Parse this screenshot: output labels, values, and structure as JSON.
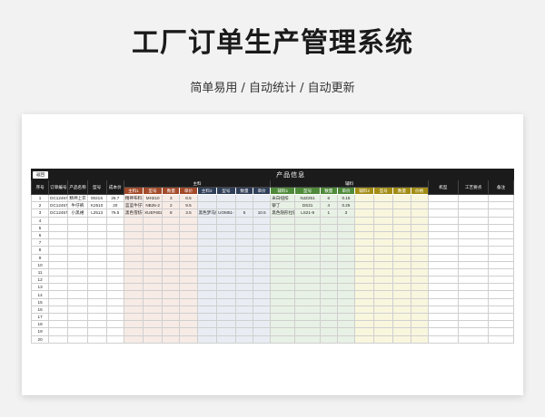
{
  "page": {
    "title": "工厂订单生产管理系统",
    "subtitle": "简单易用  /  自动统计  /  自动更新"
  },
  "sheet": {
    "back_label": "返回",
    "sheet_title": "产品信息",
    "group_labels": {
      "main": "主料",
      "aux": "辅料"
    },
    "columns": {
      "seq": "序号",
      "order_no": "订单编号",
      "product_name": "产品名称",
      "model": "型号",
      "cost_price": "成本价",
      "machine": "机型",
      "key_process": "工艺要点",
      "remarks": "备注"
    },
    "main_sub_a": [
      "主料1",
      "型号",
      "数量",
      "单价"
    ],
    "main_sub_b": [
      "主料2",
      "型号",
      "数量",
      "单价"
    ],
    "aux_sub_a": [
      "辅料1",
      "型号",
      "数量",
      "单价"
    ],
    "aux_sub_b": [
      "辅料2",
      "型号",
      "数量",
      "价格"
    ],
    "colors": {
      "banner": "#1b1b1b",
      "main_a_header": "#a34a2a",
      "main_b_header": "#2f3e57",
      "aux_a_header": "#4f8a3a",
      "aux_b_header": "#a28c14",
      "main_a_fill": "#f7ebe6",
      "main_b_fill": "#e9edf3",
      "aux_a_fill": "#e8f1e5",
      "aux_b_fill": "#f9f6de"
    },
    "rows": [
      {
        "seq": "1",
        "order_no": "DC124578",
        "product_name": "精神上衣",
        "model": "0021S",
        "cost_price": "26.7",
        "m1": "精神布料1",
        "m1_model": "MH210",
        "m1_qty": "3",
        "m1_price": "8.5",
        "m2": "",
        "m2_model": "",
        "m2_qty": "",
        "m2_price": "",
        "a1": "米白纽扣",
        "a1_model": "NJZ251",
        "a1_qty": "6",
        "a1_price": "0.15"
      },
      {
        "seq": "2",
        "order_no": "DC124578",
        "product_name": "牛仔裤",
        "model": "K2510",
        "cost_price": "20",
        "m1": "蓝蓝牛仔布",
        "m1_model": "NB25-2",
        "m1_qty": "2",
        "m1_price": "9.5",
        "m2": "",
        "m2_model": "",
        "m2_qty": "",
        "m2_price": "",
        "a1": "铆丁",
        "a1_model": "DS21",
        "a1_qty": "4",
        "a1_price": "0.25"
      },
      {
        "seq": "3",
        "order_no": "DC124578",
        "product_name": "小黑裙",
        "model": "L2513",
        "cost_price": "76.5",
        "m1": "黑色雪纺布料",
        "m1_model": "XUEF602",
        "m1_qty": "8",
        "m1_price": "3.5",
        "m2": "黑色梦马织布",
        "m2_model": "UOM51-",
        "m2_qty": "5",
        "m2_price": "10.5",
        "a1": "黑色隐形拉链",
        "a1_model": "LS21-9",
        "a1_qty": "1",
        "a1_price": "3"
      }
    ],
    "row_numbers": [
      "4",
      "5",
      "6",
      "7",
      "8",
      "9",
      "10",
      "11",
      "12",
      "13",
      "14",
      "15",
      "16",
      "17",
      "18",
      "19",
      "20"
    ]
  }
}
